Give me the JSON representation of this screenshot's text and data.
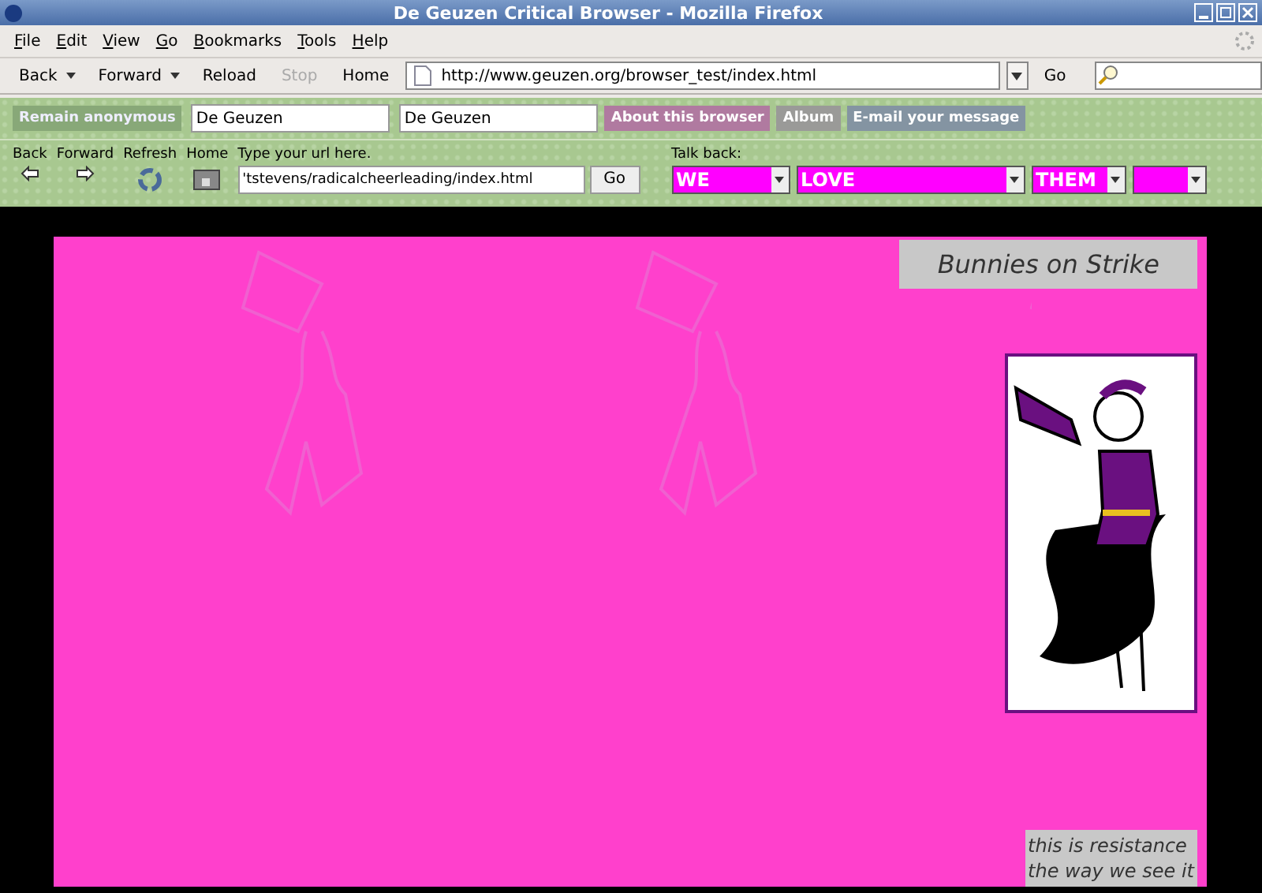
{
  "window": {
    "title": "De Geuzen Critical Browser - Mozilla Firefox"
  },
  "menu": [
    {
      "label": "File"
    },
    {
      "label": "Edit"
    },
    {
      "label": "View"
    },
    {
      "label": "Go"
    },
    {
      "label": "Bookmarks"
    },
    {
      "label": "Tools"
    },
    {
      "label": "Help"
    }
  ],
  "nav_toolbar": {
    "buttons": [
      {
        "label": "Back",
        "dropdown": true,
        "disabled": false
      },
      {
        "label": "Forward",
        "dropdown": true,
        "disabled": false
      },
      {
        "label": "Reload",
        "dropdown": false,
        "disabled": false
      },
      {
        "label": "Stop",
        "dropdown": false,
        "disabled": true
      },
      {
        "label": "Home",
        "dropdown": false,
        "disabled": false
      }
    ],
    "address": "http://www.geuzen.org/browser_test/index.html",
    "go": "Go"
  },
  "site_toolbar": {
    "anonymous_button": "Remain anonymous",
    "fields": [
      {
        "value": "De Geuzen"
      },
      {
        "value": "De Geuzen"
      }
    ],
    "links": [
      {
        "label": "About this browser",
        "color": "#b07aa0"
      },
      {
        "label": "Album",
        "color": "#9a9a98"
      },
      {
        "label": "E-mail your message",
        "color": "#8494a2"
      }
    ]
  },
  "site_nav": {
    "buttons": [
      {
        "label": "Back",
        "kind": "left"
      },
      {
        "label": "Forward",
        "kind": "right"
      },
      {
        "label": "Refresh",
        "kind": "refresh"
      },
      {
        "label": "Home",
        "kind": "home"
      }
    ],
    "url_label": "Type your url here.",
    "url_value": "'tstevens/radicalcheerleading/index.html",
    "go": "Go",
    "talk_label": "Talk back:",
    "selects": [
      {
        "kind": "word",
        "value": "WE"
      },
      {
        "kind": "word",
        "value": "LOVE"
      },
      {
        "kind": "word",
        "value": "THEM"
      },
      {
        "kind": "blank"
      }
    ]
  },
  "page": {
    "heading": "Bunnies on Strike",
    "caption": [
      "this is resistance",
      "the way we see it"
    ]
  }
}
